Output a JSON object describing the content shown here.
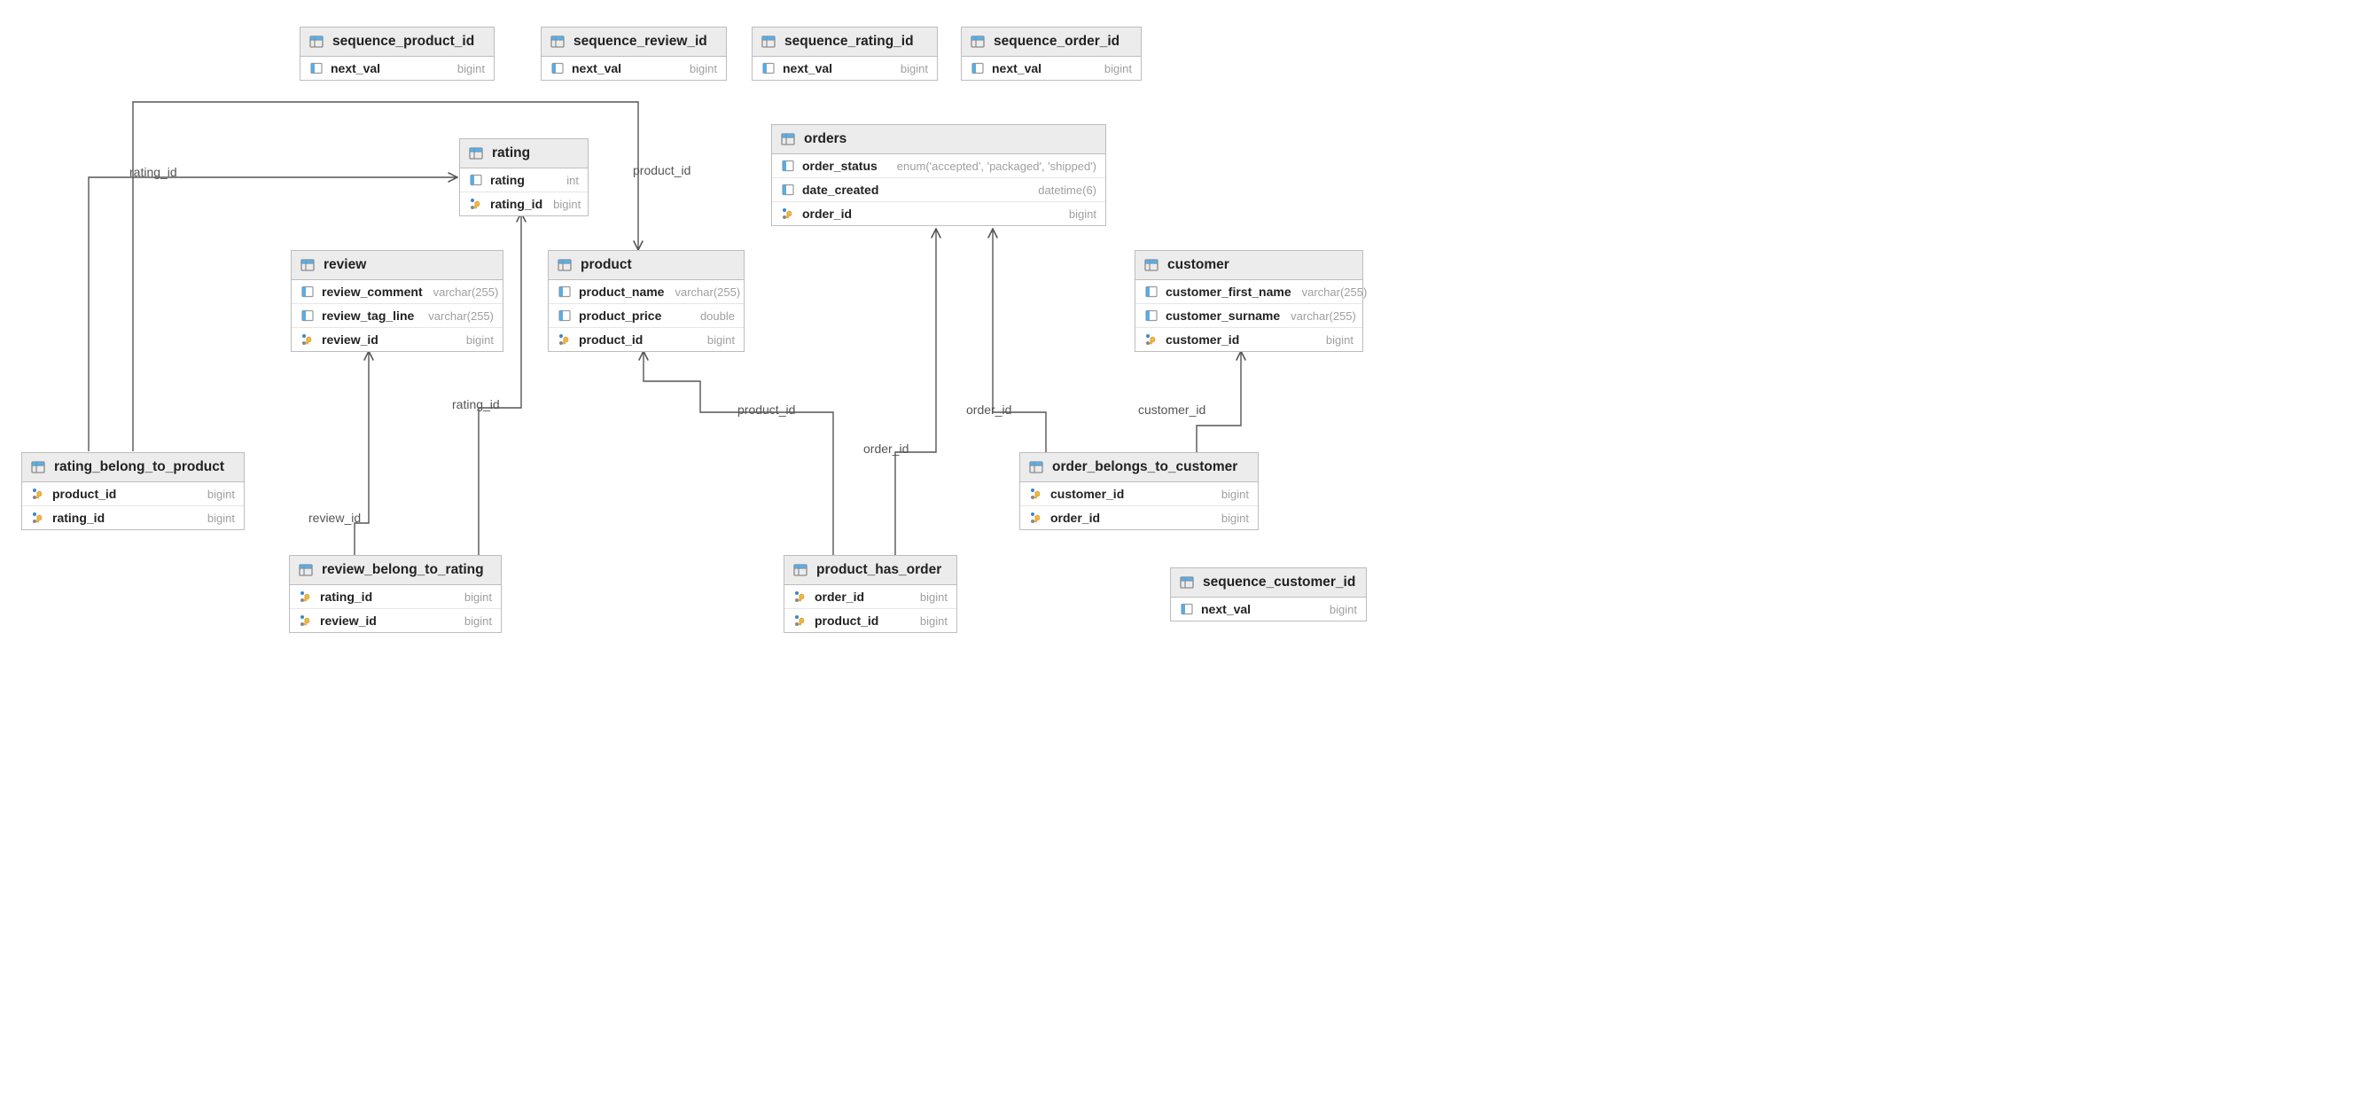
{
  "tables": {
    "sequence_product_id": {
      "title": "sequence_product_id",
      "cols": [
        {
          "name": "next_val",
          "type": "bigint",
          "icon": "col"
        }
      ]
    },
    "sequence_review_id": {
      "title": "sequence_review_id",
      "cols": [
        {
          "name": "next_val",
          "type": "bigint",
          "icon": "col"
        }
      ]
    },
    "sequence_rating_id": {
      "title": "sequence_rating_id",
      "cols": [
        {
          "name": "next_val",
          "type": "bigint",
          "icon": "col"
        }
      ]
    },
    "sequence_order_id": {
      "title": "sequence_order_id",
      "cols": [
        {
          "name": "next_val",
          "type": "bigint",
          "icon": "col"
        }
      ]
    },
    "sequence_customer_id": {
      "title": "sequence_customer_id",
      "cols": [
        {
          "name": "next_val",
          "type": "bigint",
          "icon": "col"
        }
      ]
    },
    "rating": {
      "title": "rating",
      "cols": [
        {
          "name": "rating",
          "type": "int",
          "icon": "col"
        },
        {
          "name": "rating_id",
          "type": "bigint",
          "icon": "pk"
        }
      ]
    },
    "review": {
      "title": "review",
      "cols": [
        {
          "name": "review_comment",
          "type": "varchar(255)",
          "icon": "col"
        },
        {
          "name": "review_tag_line",
          "type": "varchar(255)",
          "icon": "col"
        },
        {
          "name": "review_id",
          "type": "bigint",
          "icon": "pk"
        }
      ]
    },
    "product": {
      "title": "product",
      "cols": [
        {
          "name": "product_name",
          "type": "varchar(255)",
          "icon": "col"
        },
        {
          "name": "product_price",
          "type": "double",
          "icon": "col"
        },
        {
          "name": "product_id",
          "type": "bigint",
          "icon": "pk"
        }
      ]
    },
    "orders": {
      "title": "orders",
      "cols": [
        {
          "name": "order_status",
          "type": "enum('accepted', 'packaged', 'shipped')",
          "icon": "col"
        },
        {
          "name": "date_created",
          "type": "datetime(6)",
          "icon": "col"
        },
        {
          "name": "order_id",
          "type": "bigint",
          "icon": "pk"
        }
      ]
    },
    "customer": {
      "title": "customer",
      "cols": [
        {
          "name": "customer_first_name",
          "type": "varchar(255)",
          "icon": "col"
        },
        {
          "name": "customer_surname",
          "type": "varchar(255)",
          "icon": "col"
        },
        {
          "name": "customer_id",
          "type": "bigint",
          "icon": "pk"
        }
      ]
    },
    "rating_belong_to_product": {
      "title": "rating_belong_to_product",
      "cols": [
        {
          "name": "product_id",
          "type": "bigint",
          "icon": "fk"
        },
        {
          "name": "rating_id",
          "type": "bigint",
          "icon": "fk"
        }
      ]
    },
    "review_belong_to_rating": {
      "title": "review_belong_to_rating",
      "cols": [
        {
          "name": "rating_id",
          "type": "bigint",
          "icon": "fk"
        },
        {
          "name": "review_id",
          "type": "bigint",
          "icon": "fk"
        }
      ]
    },
    "product_has_order": {
      "title": "product_has_order",
      "cols": [
        {
          "name": "order_id",
          "type": "bigint",
          "icon": "fk"
        },
        {
          "name": "product_id",
          "type": "bigint",
          "icon": "fk"
        }
      ]
    },
    "order_belongs_to_customer": {
      "title": "order_belongs_to_customer",
      "cols": [
        {
          "name": "customer_id",
          "type": "bigint",
          "icon": "fk"
        },
        {
          "name": "order_id",
          "type": "bigint",
          "icon": "fk"
        }
      ]
    }
  },
  "labels": {
    "rating_id_1": "rating_id",
    "product_id_1": "product_id",
    "rating_id_2": "rating_id",
    "review_id": "review_id",
    "product_id_2": "product_id",
    "order_id_1": "order_id",
    "order_id_2": "order_id",
    "customer_id": "customer_id"
  }
}
